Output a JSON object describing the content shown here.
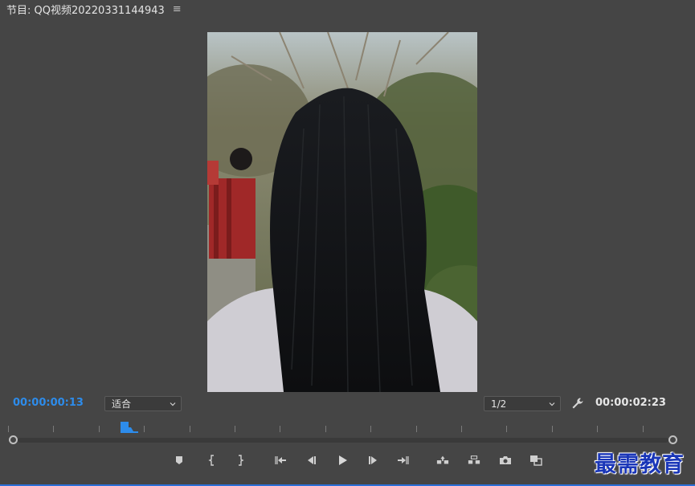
{
  "panel": {
    "title": "节目: QQ视频20220331144943",
    "menu_glyph": "≡"
  },
  "timecode": {
    "current": "00:00:00:13",
    "duration": "00:00:02:23"
  },
  "zoom_select": {
    "value": "适合"
  },
  "resolution_select": {
    "value": "1/2"
  },
  "playback": {
    "playhead_fraction": 0.17
  },
  "colors": {
    "accent": "#2d8ceb",
    "panel_bg": "#454545"
  },
  "icons": [
    "add-marker-icon",
    "mark-in-icon",
    "mark-out-icon",
    "go-to-in-icon",
    "step-back-icon",
    "play-icon",
    "step-forward-icon",
    "go-to-out-icon",
    "lift-icon",
    "extract-icon",
    "export-frame-icon",
    "comparison-view-icon",
    "wrench-icon"
  ],
  "watermark": {
    "text": "最需教育"
  }
}
